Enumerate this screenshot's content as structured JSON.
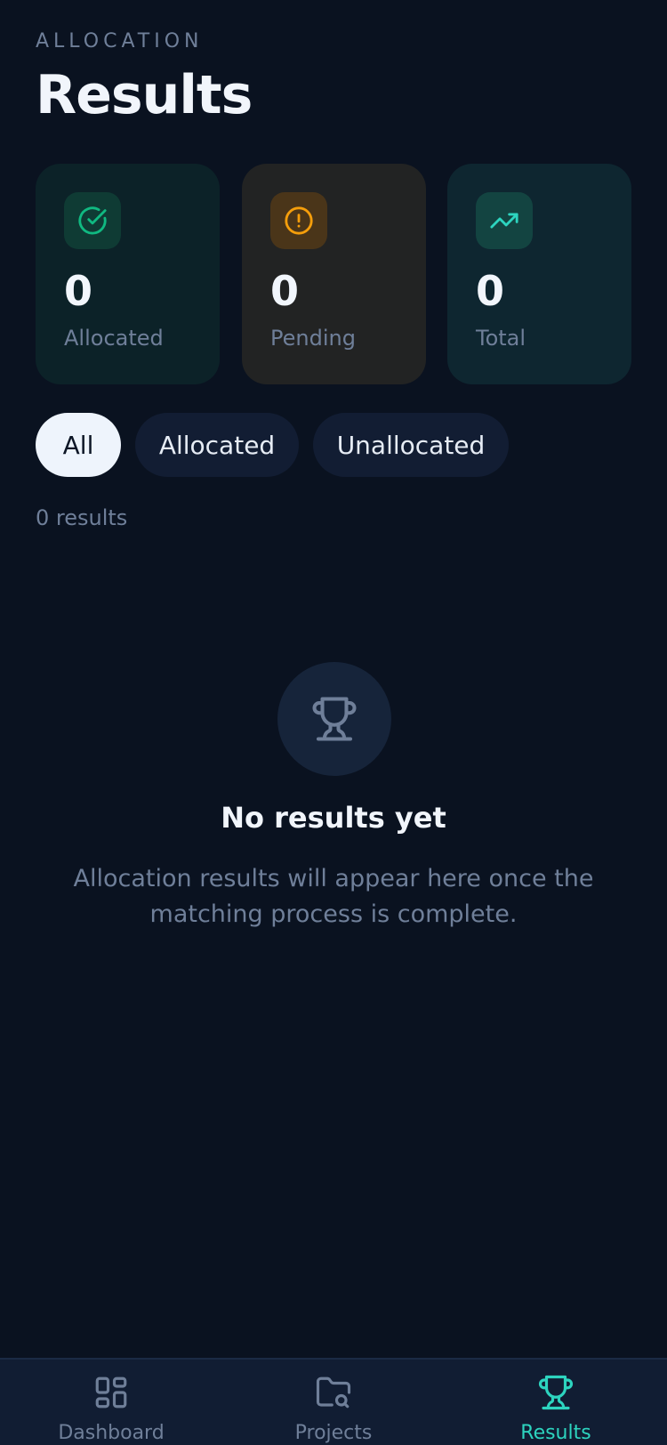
{
  "header": {
    "eyebrow": "ALLOCATION",
    "title": "Results"
  },
  "stats": [
    {
      "value": "0",
      "label": "Allocated",
      "icon": "check-circle-icon",
      "color": "#10b981"
    },
    {
      "value": "0",
      "label": "Pending",
      "icon": "alert-circle-icon",
      "color": "#f59e0b"
    },
    {
      "value": "0",
      "label": "Total",
      "icon": "trending-up-icon",
      "color": "#2dd4bf"
    }
  ],
  "filters": [
    {
      "label": "All",
      "active": true
    },
    {
      "label": "Allocated",
      "active": false
    },
    {
      "label": "Unallocated",
      "active": false
    }
  ],
  "results_count": "0 results",
  "empty_state": {
    "icon": "trophy-icon",
    "title": "No results yet",
    "description": "Allocation results will appear here once the matching process is complete."
  },
  "nav": {
    "items": [
      {
        "label": "Dashboard",
        "icon": "dashboard-icon",
        "active": false
      },
      {
        "label": "Projects",
        "icon": "folder-search-icon",
        "active": false
      },
      {
        "label": "Results",
        "icon": "trophy-icon",
        "active": true
      }
    ]
  },
  "colors": {
    "background": "#0a1220",
    "accent": "#2dd4bf",
    "muted": "#6f7f99"
  }
}
